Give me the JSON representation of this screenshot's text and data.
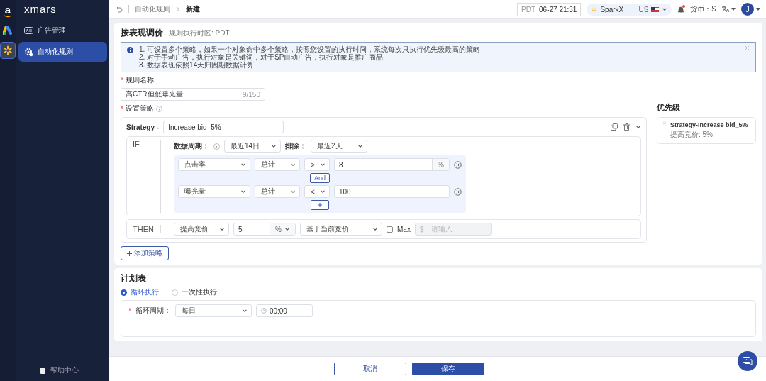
{
  "rail": [
    {
      "kind": "amazon",
      "label": "a",
      "selected": false
    },
    {
      "kind": "google-ads",
      "selected": false
    },
    {
      "kind": "walmart",
      "selected": true
    }
  ],
  "sidebar": {
    "logo": "xmars",
    "items": [
      {
        "kind": "ads",
        "label": "广告管理",
        "selected": false
      },
      {
        "kind": "rules",
        "label": "自动化规则",
        "selected": true
      }
    ],
    "help": "帮助中心"
  },
  "topbar": {
    "breadcrumb": [
      "自动化规则",
      "新建"
    ],
    "timezone": "PDT",
    "time": "06-27 21:31",
    "store": "SparkX",
    "country": "US",
    "notifications": true,
    "currency_label": "货币：",
    "currency": "$",
    "avatar": "J"
  },
  "rule": {
    "title": "按表现调价",
    "timezone_note": "规则执行时区: PDT",
    "notice": [
      "1. 可设置多个策略，如果一个对象命中多个策略，按照您设置的执行时间，系统每次只执行优先级最高的策略",
      "2. 对于手动广告，执行对象是关键词，对于SP自动广告，执行对象是推广商品",
      "3. 数据表现依照14天归因期数据计算"
    ],
    "name_mark": "*",
    "name_label": "规则名称",
    "name_value": "高CTR但低曝光量",
    "name_count": "9/150",
    "strategy_mark": "*",
    "strategy_label": "设置策略",
    "strategy": {
      "prefix": "Strategy -",
      "name": "Increase bid_5%",
      "if_label": "IF",
      "period_label": "数据周期：",
      "period": "最近14日",
      "exclude_label": "排除：",
      "exclude": "最近2天",
      "conditions": [
        {
          "metric": "点击率",
          "aggregate": "总计",
          "operator": ">",
          "value": "8",
          "unit": "%"
        },
        {
          "metric": "曝光量",
          "aggregate": "总计",
          "operator": "<",
          "value": "100"
        }
      ],
      "connector": "And",
      "then_label": "THEN",
      "action": "提高竞价",
      "amount": "5",
      "amount_unit": "%",
      "basis": "基于当前竞价",
      "max_checked": false,
      "max_label": "Max",
      "max_currency": "$",
      "max_placeholder": "请输入"
    },
    "add_strategy": "添加策略",
    "priority_title": "优先级",
    "priority": [
      {
        "name": "Strategy-Increase bid_5%",
        "detail": "提高竞价: 5%"
      }
    ]
  },
  "schedule": {
    "title": "计划表",
    "modes": [
      {
        "label": "循环执行",
        "selected": true
      },
      {
        "label": "一次性执行",
        "selected": false
      }
    ],
    "cycle_mark": "*",
    "cycle_label": "循环周期：",
    "cycle": "每日",
    "time": "00:00"
  },
  "footer": {
    "cancel": "取消",
    "save": "保存"
  }
}
